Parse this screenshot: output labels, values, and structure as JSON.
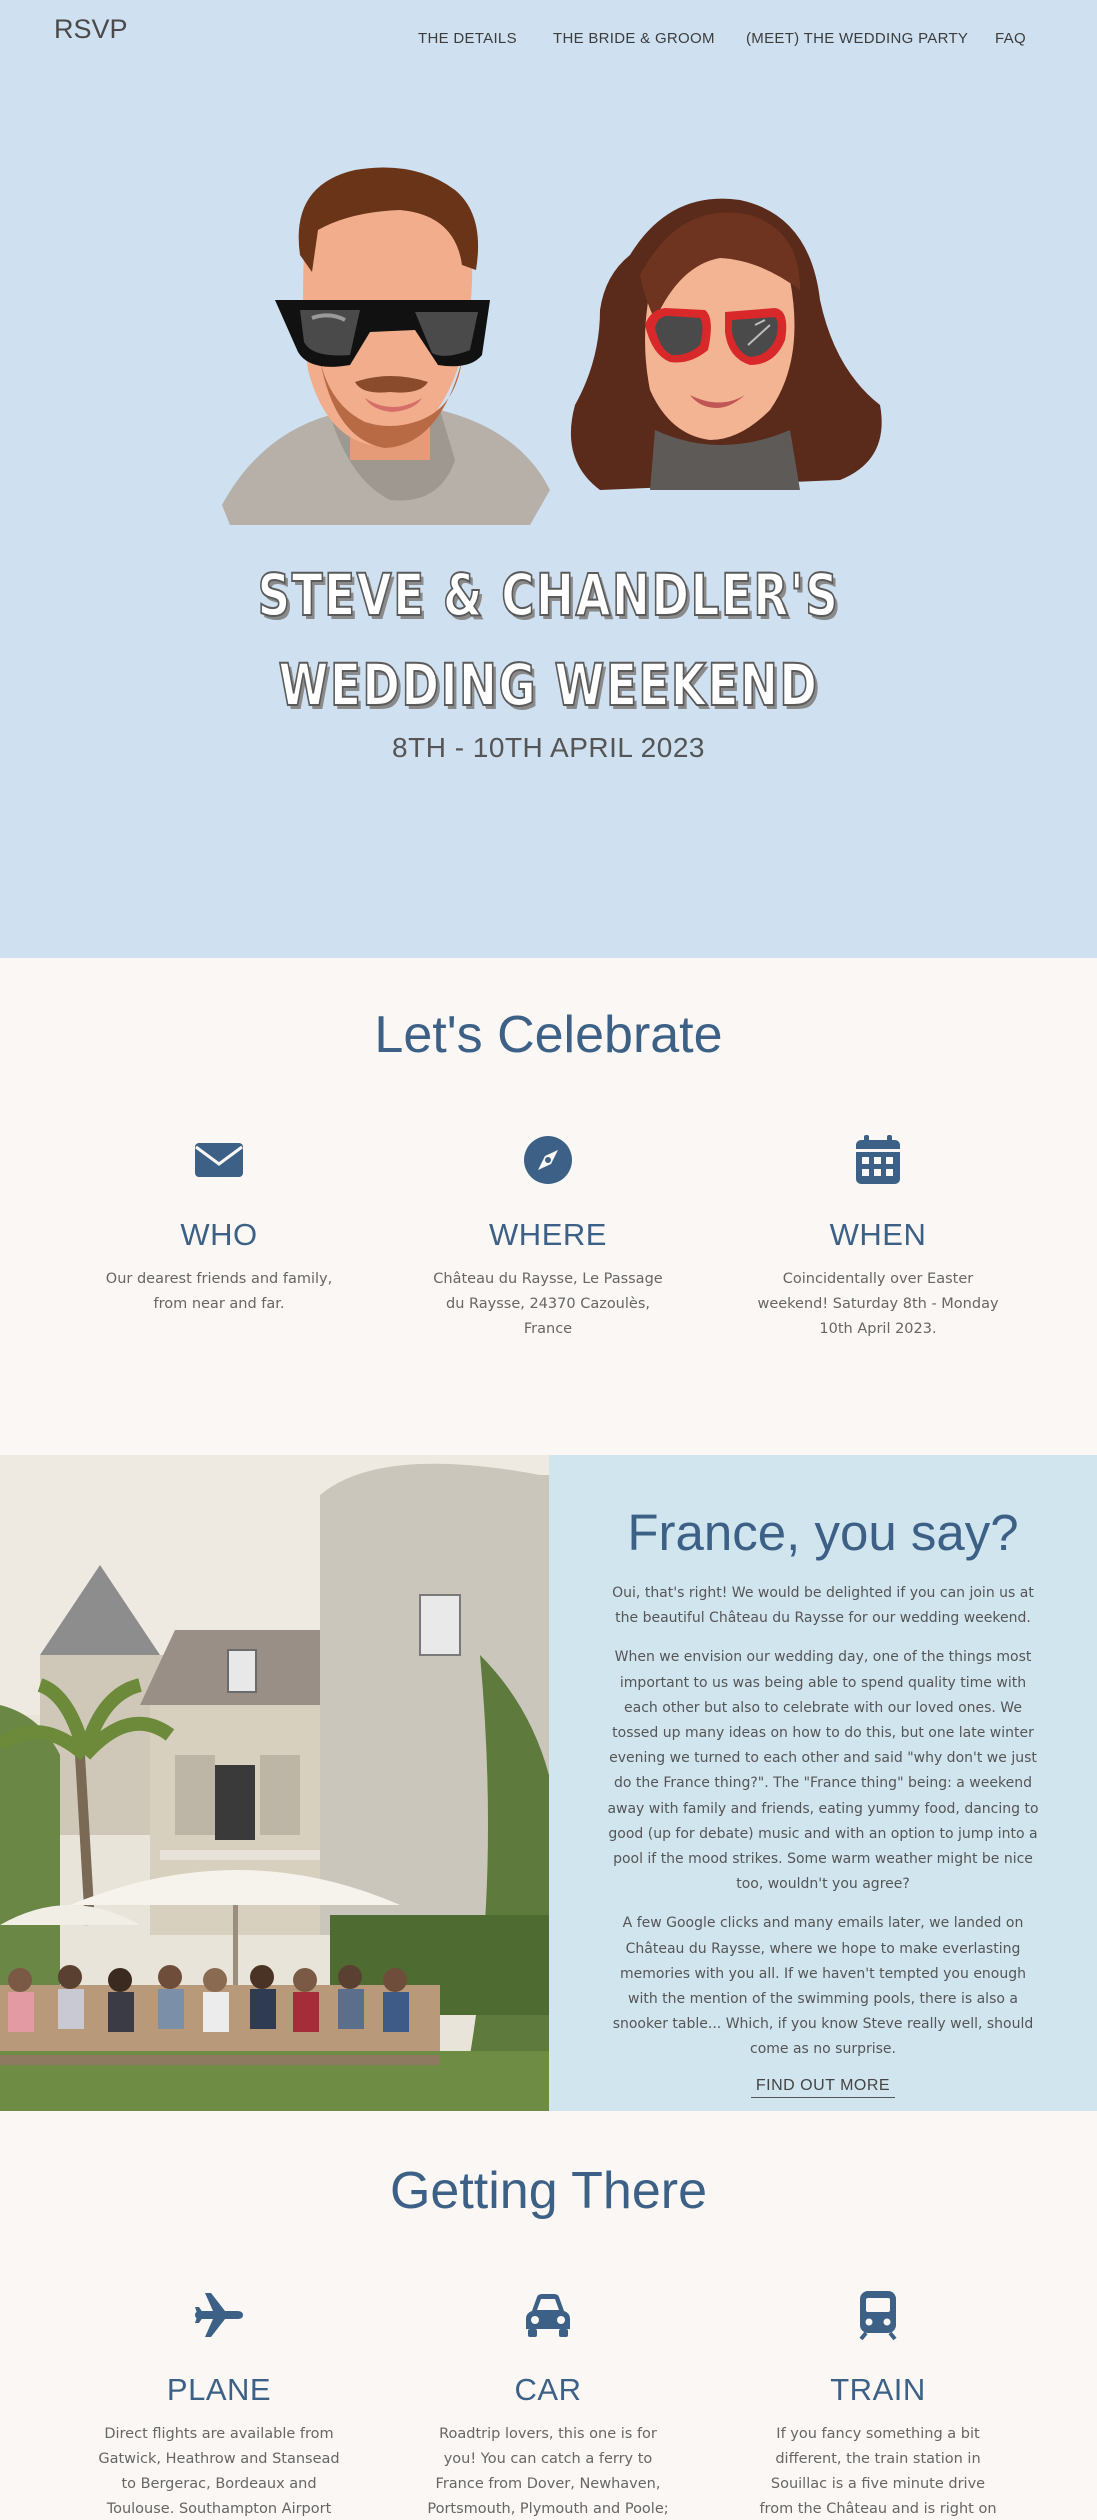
{
  "nav": {
    "brand": "RSVP",
    "links": [
      "THE DETAILS",
      "THE BRIDE & GROOM",
      "(MEET) THE WEDDING PARTY",
      "FAQ"
    ]
  },
  "hero": {
    "title_line1": "STEVE & CHANDLER'S",
    "title_line2": "WEDDING WEEKEND",
    "dates": "8TH - 10TH APRIL 2023"
  },
  "celebrate": {
    "heading": "Let's Celebrate",
    "items": [
      {
        "icon": "envelope-icon",
        "title": "WHO",
        "text": "Our dearest friends and family, from near and far."
      },
      {
        "icon": "compass-icon",
        "title": "WHERE",
        "text": "Château du Raysse, Le Passage du Raysse, 24370 Cazoulès, France"
      },
      {
        "icon": "calendar-icon",
        "title": "WHEN",
        "text": "Coincidentally over Easter weekend! Saturday 8th - Monday 10th April 2023."
      }
    ]
  },
  "france": {
    "heading": "France, you say?",
    "paragraphs": [
      "Oui, that's right! We would be delighted if you can join us at the beautiful Château du Raysse for our wedding weekend.",
      "When we envision our wedding day, one of the things most important to us was being able to spend quality time with each other but also to celebrate with our loved ones. We tossed up many ideas on how to do this, but one late winter evening we turned to each other and said \"why don't we just do the France thing?\". The \"France thing\" being: a weekend away with family and friends, eating yummy food, dancing to good (up for debate) music and with an option to jump into a pool if the mood strikes. Some warm weather might be nice too, wouldn't you agree?",
      "A few Google clicks and many emails later, we landed on Château du Raysse, where we hope to make everlasting memories with you all. If we haven't tempted you enough with the mention of the swimming pools, there is also a snooker table... Which, if you know Steve really well, should come as no surprise."
    ],
    "cta": "FIND OUT MORE"
  },
  "getting_there": {
    "heading": "Getting There",
    "items": [
      {
        "icon": "plane-icon",
        "title": "PLANE",
        "text": "Direct flights are available from Gatwick, Heathrow and Stansead to Bergerac, Bordeaux and Toulouse. Southampton Airport"
      },
      {
        "icon": "car-icon",
        "title": "CAR",
        "text": "Roadtrip lovers, this one is for you! You can catch a ferry to France from Dover, Newhaven, Portsmouth, Plymouth and Poole;"
      },
      {
        "icon": "train-icon",
        "title": "TRAIN",
        "text": "If you fancy something a bit different, the train station in Souillac is a five minute drive from the Château and is right on the"
      }
    ]
  },
  "colors": {
    "hero_bg": "#cfe0f0",
    "accent": "#3d6186",
    "france_panel_bg": "#d1e5ef",
    "page_bg": "#faf7f4"
  }
}
